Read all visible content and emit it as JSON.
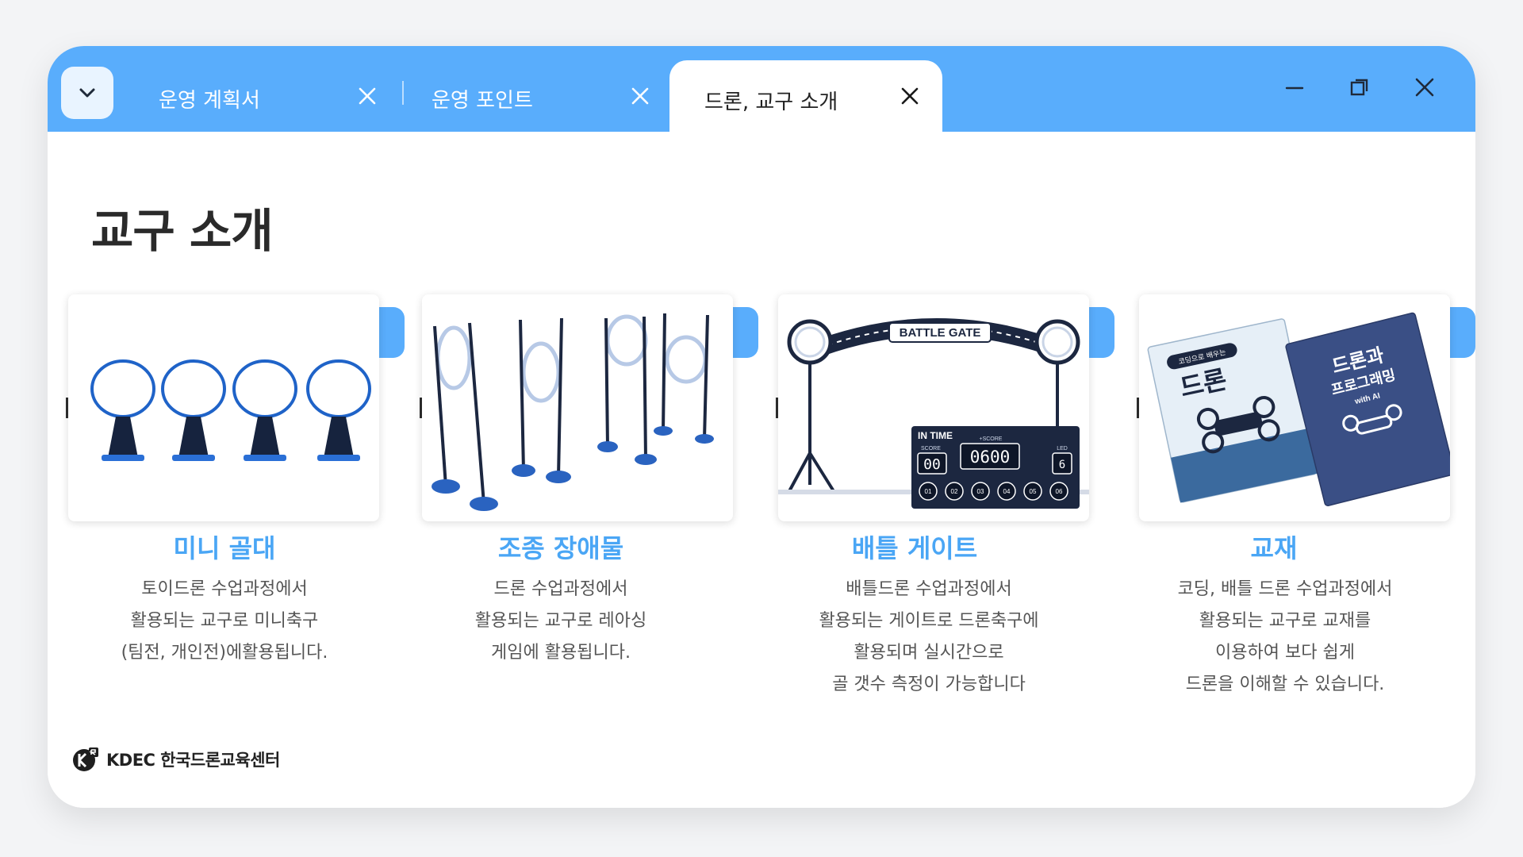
{
  "colors": {
    "accent": "#59adfc",
    "feature_title": "#4aa6f5",
    "page_bg": "#f3f4f6"
  },
  "tabbar": {
    "menu_icon": "chevron-down-icon",
    "tabs": [
      {
        "label": "운영 계획서",
        "active": false
      },
      {
        "label": "운영 포인트",
        "active": false
      },
      {
        "label": "드론, 교구 소개",
        "active": true
      }
    ],
    "window_controls": [
      "minimize-icon",
      "restore-icon",
      "close-icon"
    ]
  },
  "page": {
    "title": "교구 소개"
  },
  "features": [
    {
      "title": "미니 골대",
      "image": "mini-goal-image",
      "desc": [
        "토이드론 수업과정에서",
        "활용되는 교구로 미니축구",
        "(팀전, 개인전)에활용됩니다."
      ]
    },
    {
      "title": "조종 장애물",
      "image": "obstacle-image",
      "desc": [
        "드론 수업과정에서",
        "활용되는 교구로 레아싱",
        "게임에 활용됩니다."
      ]
    },
    {
      "title": "배틀 게이트",
      "image": "battle-gate-image",
      "desc": [
        "배틀드론 수업과정에서",
        "활용되는 게이트로 드론축구에",
        "활용되며 실시간으로",
        "골 갯수 측정이 가능합니다"
      ]
    },
    {
      "title": "교재",
      "image": "textbook-image",
      "desc": [
        "코딩, 배틀 드론 수업과정에서",
        "활용되는 교구로 교재를",
        "이용하여 보다 쉽게",
        "드론을 이해할 수 있습니다."
      ]
    }
  ],
  "gate_image_text": {
    "banner": "BATTLE GATE",
    "in_time": "IN TIME",
    "score_label": "SCORE",
    "time_value": "00",
    "plus_score": "+SCORE",
    "score_value": "0600",
    "led_label": "LED",
    "led_value": "6",
    "slots": [
      "01",
      "02",
      "03",
      "04",
      "05",
      "06"
    ]
  },
  "book_image_text": {
    "book1_sub": "코딩으로 배우는",
    "book1_title": "드론",
    "book2_title_1": "드론과",
    "book2_title_2": "프로그래밍",
    "book2_sub": "with AI"
  },
  "footer": {
    "logo_text": "KDEC 한국드론교육센터"
  }
}
